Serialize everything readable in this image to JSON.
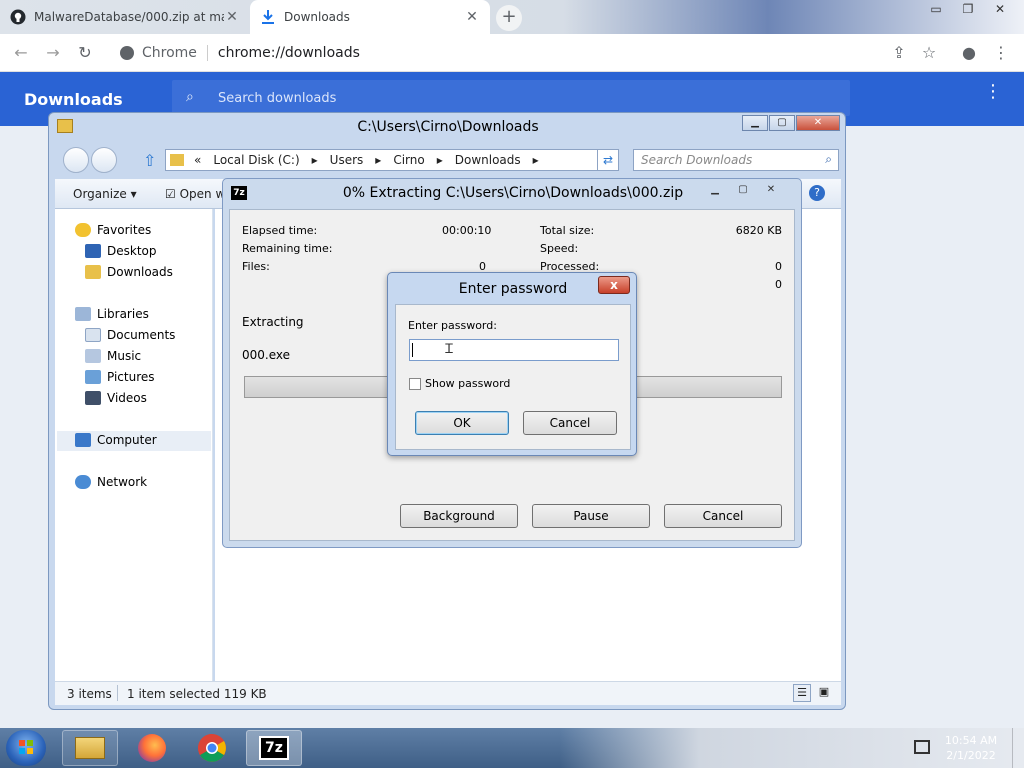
{
  "browser": {
    "tabs": [
      {
        "title": "MalwareDatabase/000.zip at ma",
        "active": false
      },
      {
        "title": "Downloads",
        "active": true
      }
    ],
    "omnibox": {
      "site": "Chrome",
      "url": "chrome://downloads"
    }
  },
  "downloads_page": {
    "title": "Downloads",
    "search_placeholder": "Search downloads"
  },
  "explorer": {
    "title": "C:\\Users\\Cirno\\Downloads",
    "breadcrumb": [
      "«",
      "Local Disk (C:)",
      "Users",
      "Cirno",
      "Downloads"
    ],
    "search_placeholder": "Search Downloads",
    "command_bar": {
      "organize": "Organize ▾",
      "open_with": "Open w"
    },
    "nav": {
      "favorites": "Favorites",
      "desktop": "Desktop",
      "downloads": "Downloads",
      "libraries": "Libraries",
      "documents": "Documents",
      "music": "Music",
      "pictures": "Pictures",
      "videos": "Videos",
      "computer": "Computer",
      "network": "Network"
    },
    "status": {
      "items": "3 items",
      "selected": "1 item selected  119 KB"
    }
  },
  "zip": {
    "title": "0% Extracting C:\\Users\\Cirno\\Downloads\\000.zip",
    "logo": "7z",
    "left": [
      {
        "label": "Elapsed time:",
        "value": "00:00:10"
      },
      {
        "label": "Remaining time:",
        "value": ""
      },
      {
        "label": "Files:",
        "value": "0"
      }
    ],
    "right": [
      {
        "label": "Total size:",
        "value": "6820 KB"
      },
      {
        "label": "Speed:",
        "value": ""
      },
      {
        "label": "Processed:",
        "value": "0"
      },
      {
        "label": "",
        "value": "0"
      }
    ],
    "extracting_label": "Extracting",
    "current_file": "000.exe",
    "progress": 0,
    "buttons": {
      "background": "Background",
      "pause": "Pause",
      "cancel": "Cancel"
    }
  },
  "password_dialog": {
    "title": "Enter password",
    "close": "x",
    "field_label": "Enter password:",
    "value": "",
    "show_password": "Show password",
    "ok": "OK",
    "cancel": "Cancel"
  },
  "taskbar": {
    "apps": [
      "file-explorer-icon",
      "firefox-icon",
      "chrome-icon",
      "7zip-icon"
    ],
    "sevenzip_label": "7z",
    "time": "10:54 AM",
    "date": "2/1/2022"
  }
}
